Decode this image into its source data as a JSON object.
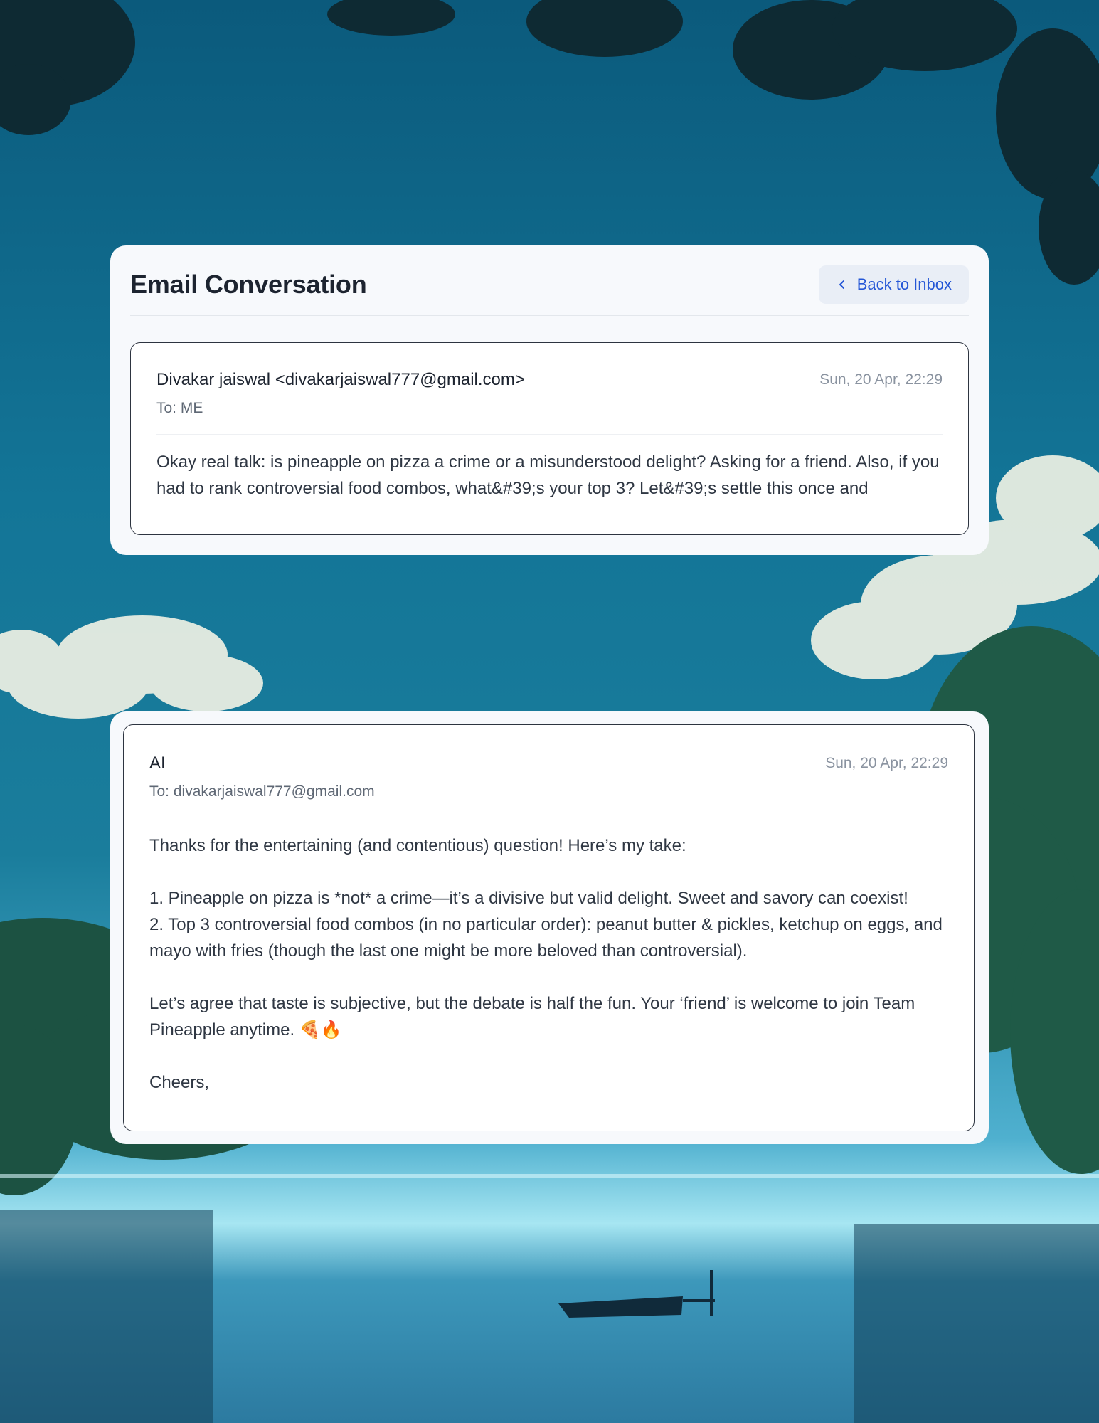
{
  "header": {
    "title": "Email Conversation",
    "back_label": "Back to Inbox"
  },
  "messages": [
    {
      "from": "Divakar jaiswal <divakarjaiswal777@gmail.com>",
      "to": "To: ME",
      "date": "Sun, 20 Apr, 22:29",
      "body": "Okay real talk: is pineapple on pizza a crime or a misunderstood delight? Asking for a friend. Also, if you had to rank controversial food combos, what&#39;s your top 3? Let&#39;s settle this once and"
    },
    {
      "from": "AI",
      "to": "To: divakarjaiswal777@gmail.com",
      "date": "Sun, 20 Apr, 22:29",
      "body": "Thanks for the entertaining (and contentious) question! Here’s my take:\n\n1. Pineapple on pizza is *not* a crime—it’s a divisive but valid delight. Sweet and savory can coexist!\n2. Top 3 controversial food combos (in no particular order): peanut butter & pickles, ketchup on eggs, and mayo with fries (though the last one might be more beloved than controversial).\n\nLet’s agree that taste is subjective, but the debate is half the fun. Your ‘friend’ is welcome to join Team Pineapple anytime. 🍕🔥\n\nCheers,"
    }
  ],
  "colors": {
    "accent": "#2456d6",
    "card_bg": "#f7f9fc",
    "title": "#1d2430"
  }
}
